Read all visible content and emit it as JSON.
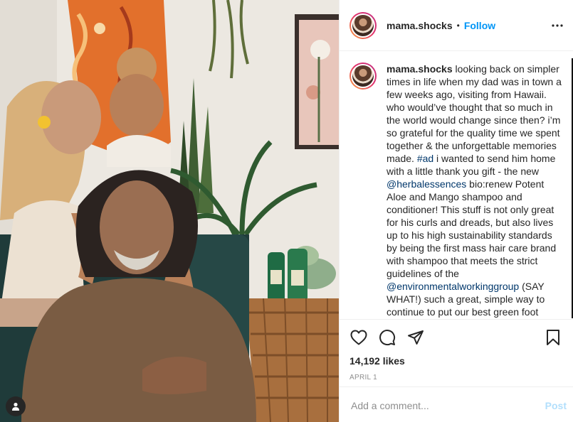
{
  "post": {
    "username": "mama.shocks",
    "separator": "•",
    "follow_label": "Follow",
    "more_icon": "more-horizontal-icon"
  },
  "caption": {
    "username": "mama.shocks",
    "part1": " looking back on simpler times in life when my dad was in town a few weeks ago, visiting from Hawaii. who would’ve thought that so much in the world would change since then? i’m so grateful for the quality time we spent together & the unforgettable memories made. ",
    "hashtag": "#ad",
    "part2": " i wanted to send him home with a little thank you gift - the new ",
    "mention1": "@herbalessences",
    "part3": " bio:renew Potent Aloe and Mango shampoo and conditioner! This stuff is not only great for his curls and dreads, but also lives up to his high sustainability standards by being the first mass hair care brand with shampoo that meets the strict guidelines of the ",
    "mention2": "@environmentalworkinggroup",
    "part4": " (SAY WHAT!) such a great, simple way to continue to put our best green foot"
  },
  "actions": {
    "icons": [
      "heart-icon",
      "comment-icon",
      "share-icon",
      "bookmark-icon"
    ],
    "likes": "14,192 likes",
    "date": "April 1"
  },
  "comment": {
    "placeholder": "Add a comment...",
    "post_label": "Post"
  },
  "colors": {
    "link_blue": "#0095f6",
    "post_disabled": "#b2dffc",
    "text": "#262626",
    "muted": "#8e8e8e"
  }
}
